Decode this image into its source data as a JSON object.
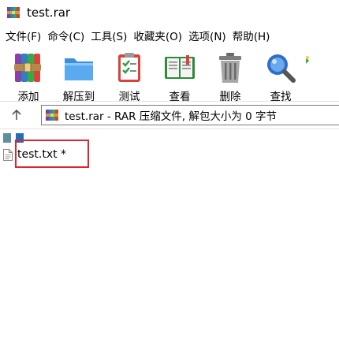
{
  "window": {
    "title": "test.rar"
  },
  "menu": [
    {
      "label": "文件(F)"
    },
    {
      "label": "命令(C)"
    },
    {
      "label": "工具(S)"
    },
    {
      "label": "收藏夹(O)"
    },
    {
      "label": "选项(N)"
    },
    {
      "label": "帮助(H)"
    }
  ],
  "toolbar": {
    "add": "添加",
    "extract": "解压到",
    "test": "测试",
    "view": "查看",
    "delete": "删除",
    "find": "查找"
  },
  "pathbar": {
    "text": "test.rar - RAR 压缩文件, 解包大小为 0 字节"
  },
  "files": [
    {
      "name": "test.txt *"
    }
  ],
  "icons": {
    "app": "winrar-archive-icon",
    "up": "up-arrow-icon",
    "file": "text-file-icon"
  },
  "colors": {
    "highlight": "#e0242b"
  }
}
